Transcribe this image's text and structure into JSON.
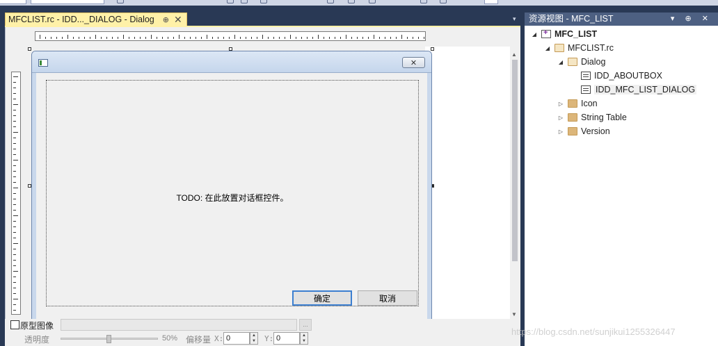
{
  "editor": {
    "tab_title": "MFCLIST.rc - IDD..._DIALOG - Dialog",
    "tab_pin": "⊕",
    "tab_close": "✕",
    "dialog": {
      "close_glyph": "✕",
      "todo_text": "TODO: 在此放置对话框控件。",
      "ok_label": "确定",
      "cancel_label": "取消"
    },
    "bottom": {
      "prototype_label": "原型图像",
      "browse_label": "...",
      "transparency_label": "透明度",
      "transparency_value": "50%",
      "offset_label": "偏移量",
      "x_label": "X:",
      "x_value": "0",
      "y_label": "Y:",
      "y_value": "0"
    }
  },
  "resource_view": {
    "title": "资源视图 - MFC_LIST",
    "title_buttons": "▾ ⊕ ✕",
    "tree": [
      {
        "label": "MFC_LIST",
        "icon": "project-icon",
        "level": 0,
        "expanded": true,
        "bold": true
      },
      {
        "label": "MFCLIST.rc",
        "icon": "folder-open-icon",
        "level": 1,
        "expanded": true
      },
      {
        "label": "Dialog",
        "icon": "folder-open-icon",
        "level": 2,
        "expanded": true
      },
      {
        "label": "IDD_ABOUTBOX",
        "icon": "dialog-resource-icon",
        "level": 3
      },
      {
        "label": "IDD_MFC_LIST_DIALOG",
        "icon": "dialog-resource-icon",
        "level": 3,
        "selected": true
      },
      {
        "label": "Icon",
        "icon": "folder-icon",
        "level": 2,
        "expanded": false
      },
      {
        "label": "String Table",
        "icon": "folder-icon",
        "level": 2,
        "expanded": false
      },
      {
        "label": "Version",
        "icon": "folder-icon",
        "level": 2,
        "expanded": false
      }
    ]
  },
  "watermark": "https://blog.csdn.net/sunjikui1255326447",
  "colors": {
    "ide_background": "#293955",
    "active_tab": "#fff1a8",
    "panel_title": "#4d6082",
    "default_button_border": "#3c7fd0"
  }
}
